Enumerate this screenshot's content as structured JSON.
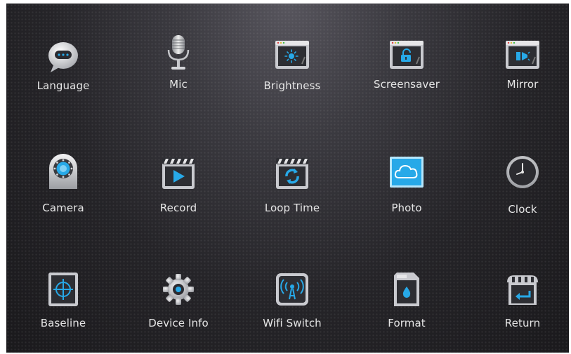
{
  "menu": {
    "items": [
      {
        "id": "language",
        "label": "Language",
        "icon": "speech-bubble-icon"
      },
      {
        "id": "mic",
        "label": "Mic",
        "icon": "microphone-icon"
      },
      {
        "id": "brightness",
        "label": "Brightness",
        "icon": "brightness-window-icon"
      },
      {
        "id": "screensaver",
        "label": "Screensaver",
        "icon": "lock-window-icon"
      },
      {
        "id": "mirror",
        "label": "Mirror",
        "icon": "mirror-window-icon"
      },
      {
        "id": "camera",
        "label": "Camera",
        "icon": "camera-icon"
      },
      {
        "id": "record",
        "label": "Record",
        "icon": "clapper-play-icon"
      },
      {
        "id": "loop-time",
        "label": "Loop Time",
        "icon": "clapper-loop-icon"
      },
      {
        "id": "photo",
        "label": "Photo",
        "icon": "photo-cloud-icon"
      },
      {
        "id": "clock",
        "label": "Clock",
        "icon": "clock-icon"
      },
      {
        "id": "baseline",
        "label": "Baseline",
        "icon": "crosshair-icon"
      },
      {
        "id": "device-info",
        "label": "Device Info",
        "icon": "gear-icon"
      },
      {
        "id": "wifi-switch",
        "label": "Wifi Switch",
        "icon": "wifi-antenna-icon"
      },
      {
        "id": "format",
        "label": "Format",
        "icon": "sd-card-icon"
      },
      {
        "id": "return",
        "label": "Return",
        "icon": "return-icon"
      }
    ]
  },
  "colors": {
    "accent": "#27a9e8",
    "label": "#e6e6e6",
    "icon_body": "#c8c9cd"
  }
}
